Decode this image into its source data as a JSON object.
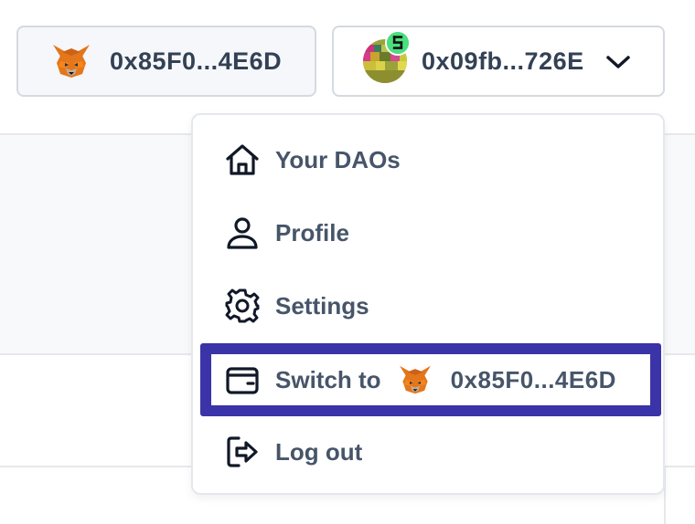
{
  "header": {
    "secondary_wallet": {
      "address": "0x85F0...4E6D",
      "icon": "metamask-fox-icon"
    },
    "active_wallet": {
      "address": "0x09fb...726E",
      "icon": "identicon-avatar",
      "expand_icon": "chevron-down-icon"
    }
  },
  "menu": {
    "items": [
      {
        "label": "Your DAOs",
        "icon": "home-icon"
      },
      {
        "label": "Profile",
        "icon": "user-icon"
      },
      {
        "label": "Settings",
        "icon": "gear-icon"
      },
      {
        "label": "Switch to",
        "icon": "wallet-icon",
        "target_address": "0x85F0...4E6D",
        "target_icon": "metamask-fox-icon",
        "highlighted": true
      },
      {
        "label": "Log out",
        "icon": "logout-icon"
      }
    ]
  },
  "colors": {
    "text": "#334155",
    "highlight_border": "#3b33a8",
    "badge": "#4ade80"
  }
}
